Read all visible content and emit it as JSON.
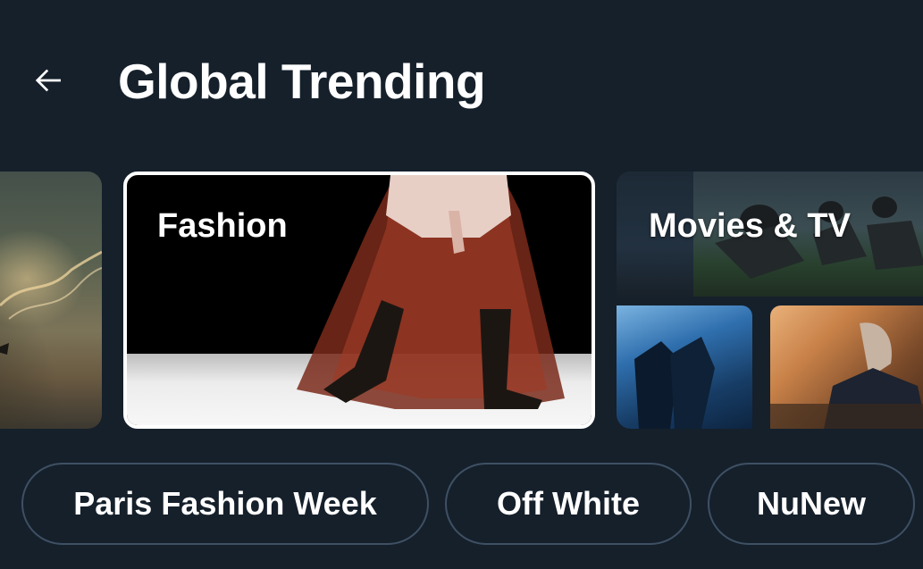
{
  "header": {
    "back_label": "Back",
    "title": "Global Trending"
  },
  "carousel": {
    "cards": [
      {
        "label": ""
      },
      {
        "label": "Fashion"
      },
      {
        "label": "Movies & TV"
      }
    ]
  },
  "chips": [
    {
      "label": "Paris Fashion Week"
    },
    {
      "label": "Off White"
    },
    {
      "label": "NuNew"
    }
  ],
  "colors": {
    "background": "#15202b",
    "chip_border": "#3f5064",
    "text": "#ffffff"
  }
}
